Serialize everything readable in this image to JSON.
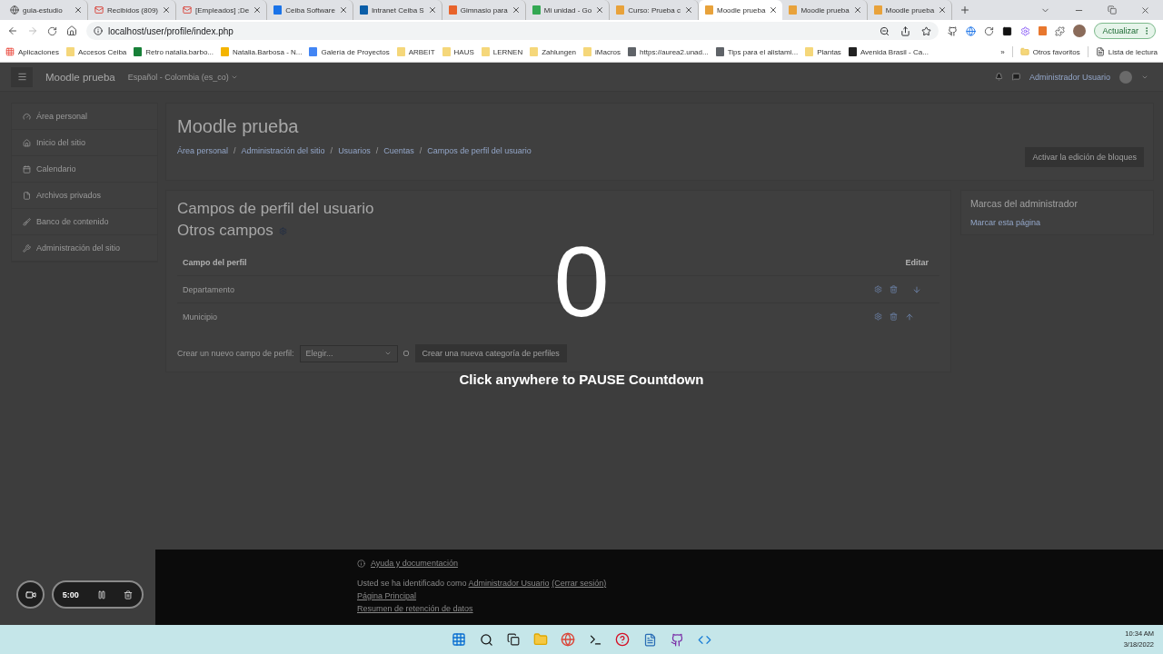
{
  "browser": {
    "tabs": [
      {
        "title": "guia-estudio",
        "selected": false
      },
      {
        "title": "Recibidos (809)",
        "selected": false
      },
      {
        "title": "[Empleados] ;De",
        "selected": false
      },
      {
        "title": "Ceiba Software",
        "selected": false
      },
      {
        "title": "Intranet Ceiba S",
        "selected": false
      },
      {
        "title": "Gimnasio para",
        "selected": false
      },
      {
        "title": "Mi unidad - Go",
        "selected": false
      },
      {
        "title": "Curso: Prueba c",
        "selected": false
      },
      {
        "title": "Moodle prueba",
        "selected": true
      },
      {
        "title": "Moodle prueba",
        "selected": false
      },
      {
        "title": "Moodle prueba",
        "selected": false
      }
    ],
    "address": "localhost/user/profile/index.php",
    "update_button": "Actualizar",
    "bookmarks": [
      "Aplicaciones",
      "Accesos Ceiba",
      "Retro natalia.barbo...",
      "Natalia.Barbosa - N...",
      "Galería de Proyectos",
      "ARBEIT",
      "HAUS",
      "LERNEN",
      "Zahlungen",
      "iMacros",
      "https://aurea2.unad...",
      "Tips para el alistami...",
      "Plantas",
      "Avenida Brasil - Ca..."
    ],
    "more_bookmarks": "»",
    "other_bookmarks": "Otros favoritos",
    "reading_list": "Lista de lectura"
  },
  "navbar": {
    "site_name": "Moodle prueba",
    "language": "Español - Colombia (es_co)",
    "user_name": "Administrador Usuario"
  },
  "sidebar": {
    "items": [
      "Área personal",
      "Inicio del sitio",
      "Calendario",
      "Archivos privados",
      "Banco de contenido",
      "Administración del sitio"
    ]
  },
  "header": {
    "title": "Moodle prueba",
    "breadcrumb_separator": "/",
    "breadcrumb": [
      "Área personal",
      "Administración del sitio",
      "Usuarios",
      "Cuentas",
      "Campos de perfil del usuario"
    ],
    "edit_button": "Activar la edición de bloques"
  },
  "content": {
    "title": "Campos de perfil del usuario",
    "subtitle": "Otros campos",
    "table": {
      "columns": [
        "Campo del perfil",
        "Editar"
      ],
      "rows": [
        {
          "name": "Departamento",
          "kind": "down"
        },
        {
          "name": "Municipio",
          "kind": "up"
        }
      ]
    },
    "new_field_label": "Crear un nuevo campo de perfil:",
    "select_value": "Elegir...",
    "or": "O",
    "new_category_button": "Crear una nueva categoría de perfiles"
  },
  "block": {
    "title": "Marcas del administrador",
    "link": "Marcar esta página"
  },
  "footer": {
    "help": "Ayuda y documentación",
    "login_prefix": "Usted se ha identificado como",
    "login_user": "Administrador Usuario",
    "logout": "(Cerrar sesión)",
    "links": [
      "Página Principal",
      "Resumen de retención de datos"
    ]
  },
  "countdown": {
    "number": "0",
    "hint": "Click anywhere to PAUSE Countdown"
  },
  "recorder": {
    "time": "5:00"
  },
  "taskbar": {
    "time": "10:34 AM",
    "date": "3/18/2022"
  }
}
